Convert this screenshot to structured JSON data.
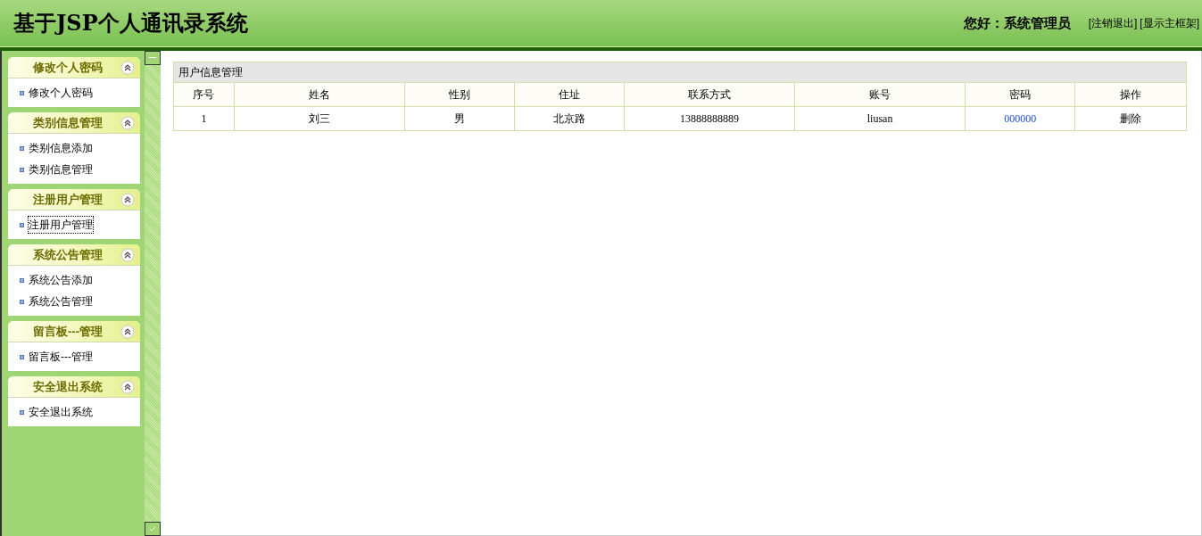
{
  "header": {
    "title": "基于JSP个人通讯录系统",
    "greeting": "您好：系统管理员",
    "links": [
      "[注销退出]",
      "[显示主框架]"
    ]
  },
  "sidebar": {
    "panels": [
      {
        "title": "修改个人密码",
        "items": [
          {
            "label": "修改个人密码",
            "focused": false
          }
        ]
      },
      {
        "title": "类别信息管理",
        "items": [
          {
            "label": "类别信息添加",
            "focused": false
          },
          {
            "label": "类别信息管理",
            "focused": false
          }
        ]
      },
      {
        "title": "注册用户管理",
        "items": [
          {
            "label": "注册用户管理",
            "focused": true
          }
        ]
      },
      {
        "title": "系统公告管理",
        "items": [
          {
            "label": "系统公告添加",
            "focused": false
          },
          {
            "label": "系统公告管理",
            "focused": false
          }
        ]
      },
      {
        "title": "留言板---管理",
        "items": [
          {
            "label": "留言板---管理",
            "focused": false
          }
        ]
      },
      {
        "title": "安全退出系统",
        "items": [
          {
            "label": "安全退出系统",
            "focused": false
          }
        ]
      }
    ]
  },
  "table": {
    "title": "用户信息管理",
    "columns": [
      "序号",
      "姓名",
      "性别",
      "住址",
      "联系方式",
      "账号",
      "密码",
      "操作"
    ],
    "rows": [
      [
        {
          "text": "1",
          "kind": "text"
        },
        {
          "text": "刘三",
          "kind": "text"
        },
        {
          "text": "男",
          "kind": "text"
        },
        {
          "text": "北京路",
          "kind": "text"
        },
        {
          "text": "13888888889",
          "kind": "text"
        },
        {
          "text": "liusan",
          "kind": "text"
        },
        {
          "text": "000000",
          "kind": "link"
        },
        {
          "text": "删除",
          "kind": "action"
        }
      ]
    ]
  }
}
